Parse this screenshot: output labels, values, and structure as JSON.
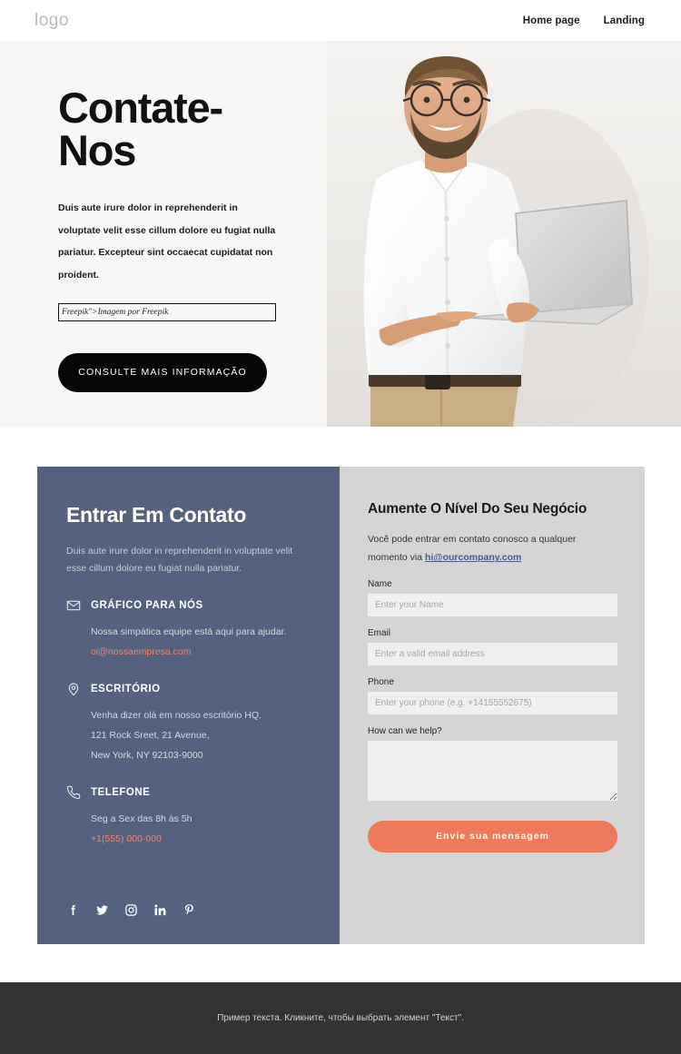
{
  "header": {
    "logo": "logo",
    "nav": [
      {
        "label": "Home page"
      },
      {
        "label": "Landing"
      }
    ]
  },
  "hero": {
    "title": "Contate-Nos",
    "paragraph": "Duis aute irure dolor in reprehenderit in voluptate velit esse cillum dolore eu fugiat nulla pariatur. Excepteur sint occaecat cupidatat non proident.",
    "attribution": "Freepik\">Imagem por Freepik",
    "cta_label": "CONSULTE MAIS INFORMAÇÃO",
    "photo_alt": "smiling bearded man with glasses in white shirt holding a silver laptop"
  },
  "contact": {
    "left": {
      "title": "Entrar Em Contato",
      "subtitle": "Duis aute irure dolor in reprehenderit in voluptate velit esse cillum dolore eu fugiat nulla pariatur.",
      "blocks": [
        {
          "icon": "envelope-icon",
          "title": "GRÁFICO PARA NÓS",
          "lines": [
            "Nossa simpática equipe está aqui para ajudar."
          ],
          "link": "oi@nossaempresa.com"
        },
        {
          "icon": "map-pin-icon",
          "title": "ESCRITÓRIO",
          "lines": [
            "Venha dizer olá em nosso escritório HQ.",
            "121 Rock Sreet, 21 Avenue,",
            "New York, NY 92103-9000"
          ],
          "link": ""
        },
        {
          "icon": "phone-icon",
          "title": "TELEFONE",
          "lines": [
            "Seg a Sex das 8h às 5h"
          ],
          "link": "+1(555) 000-000"
        }
      ],
      "socials": [
        {
          "name": "facebook-icon"
        },
        {
          "name": "twitter-icon"
        },
        {
          "name": "instagram-icon"
        },
        {
          "name": "linkedin-icon"
        },
        {
          "name": "pinterest-icon"
        }
      ]
    },
    "right": {
      "title": "Aumente O Nível Do Seu Negócio",
      "subtitle_before": "Você pode entrar em contato conosco a qualquer momento via ",
      "subtitle_link": "hi@ourcompany.com",
      "fields": [
        {
          "label": "Name",
          "placeholder": "Enter your Name",
          "value": ""
        },
        {
          "label": "Email",
          "placeholder": "Enter a valid email address",
          "value": ""
        },
        {
          "label": "Phone",
          "placeholder": "Enter your phone (e.g. +14155552675)",
          "value": ""
        }
      ],
      "message_label": "How can we help?",
      "message_value": "",
      "submit_label": "Envie sua mensagem"
    }
  },
  "footer": {
    "text": "Пример текста. Кликните, чтобы выбрать элемент \"Текст\"."
  },
  "colors": {
    "hero_bg": "#f9f7f5",
    "panel_left_bg": "#55617f",
    "panel_right_bg": "#d5d5d5",
    "accent_orange": "#ee7a5b",
    "link_salmon": "#e58570",
    "link_blue": "#4a5a8c",
    "footer_bg": "#333333",
    "cta_black": "#060606"
  }
}
